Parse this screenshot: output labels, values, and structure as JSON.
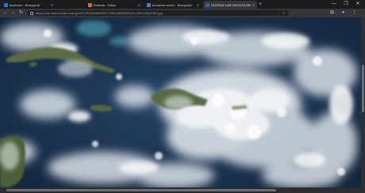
{
  "tabs": [
    {
      "title": "facebook - Búsqueda",
      "favicon_color": "#1877f2"
    },
    {
      "title": "Entrada - Editar",
      "favicon_color": "#f0622d"
    },
    {
      "title": "tormenta center - Búsqueda",
      "favicon_color": "#4a7fd4"
    },
    {
      "title": "GOES16 CAR GEOCOLOR 1000x",
      "favicon_color": "#3b5fb0",
      "active": true
    }
  ],
  "address_bar": {
    "url": "https://cdn.star.nesdis.noaa.gov/GOES16/ABI/SECTOR/CAR/GEOCOLOR/1000x1000.jpg"
  },
  "icons": {
    "back": "←",
    "forward": "→",
    "reload": "↻",
    "new_tab": "+",
    "minimize": "—",
    "maximize": "❐",
    "close": "✕",
    "bookmark": "☆",
    "extensions": "⊞",
    "profile": "●",
    "menu": "⋮"
  },
  "colors": {
    "ocean": "#1c3652",
    "cloud": "#e9edf1",
    "land": "#52623e"
  }
}
